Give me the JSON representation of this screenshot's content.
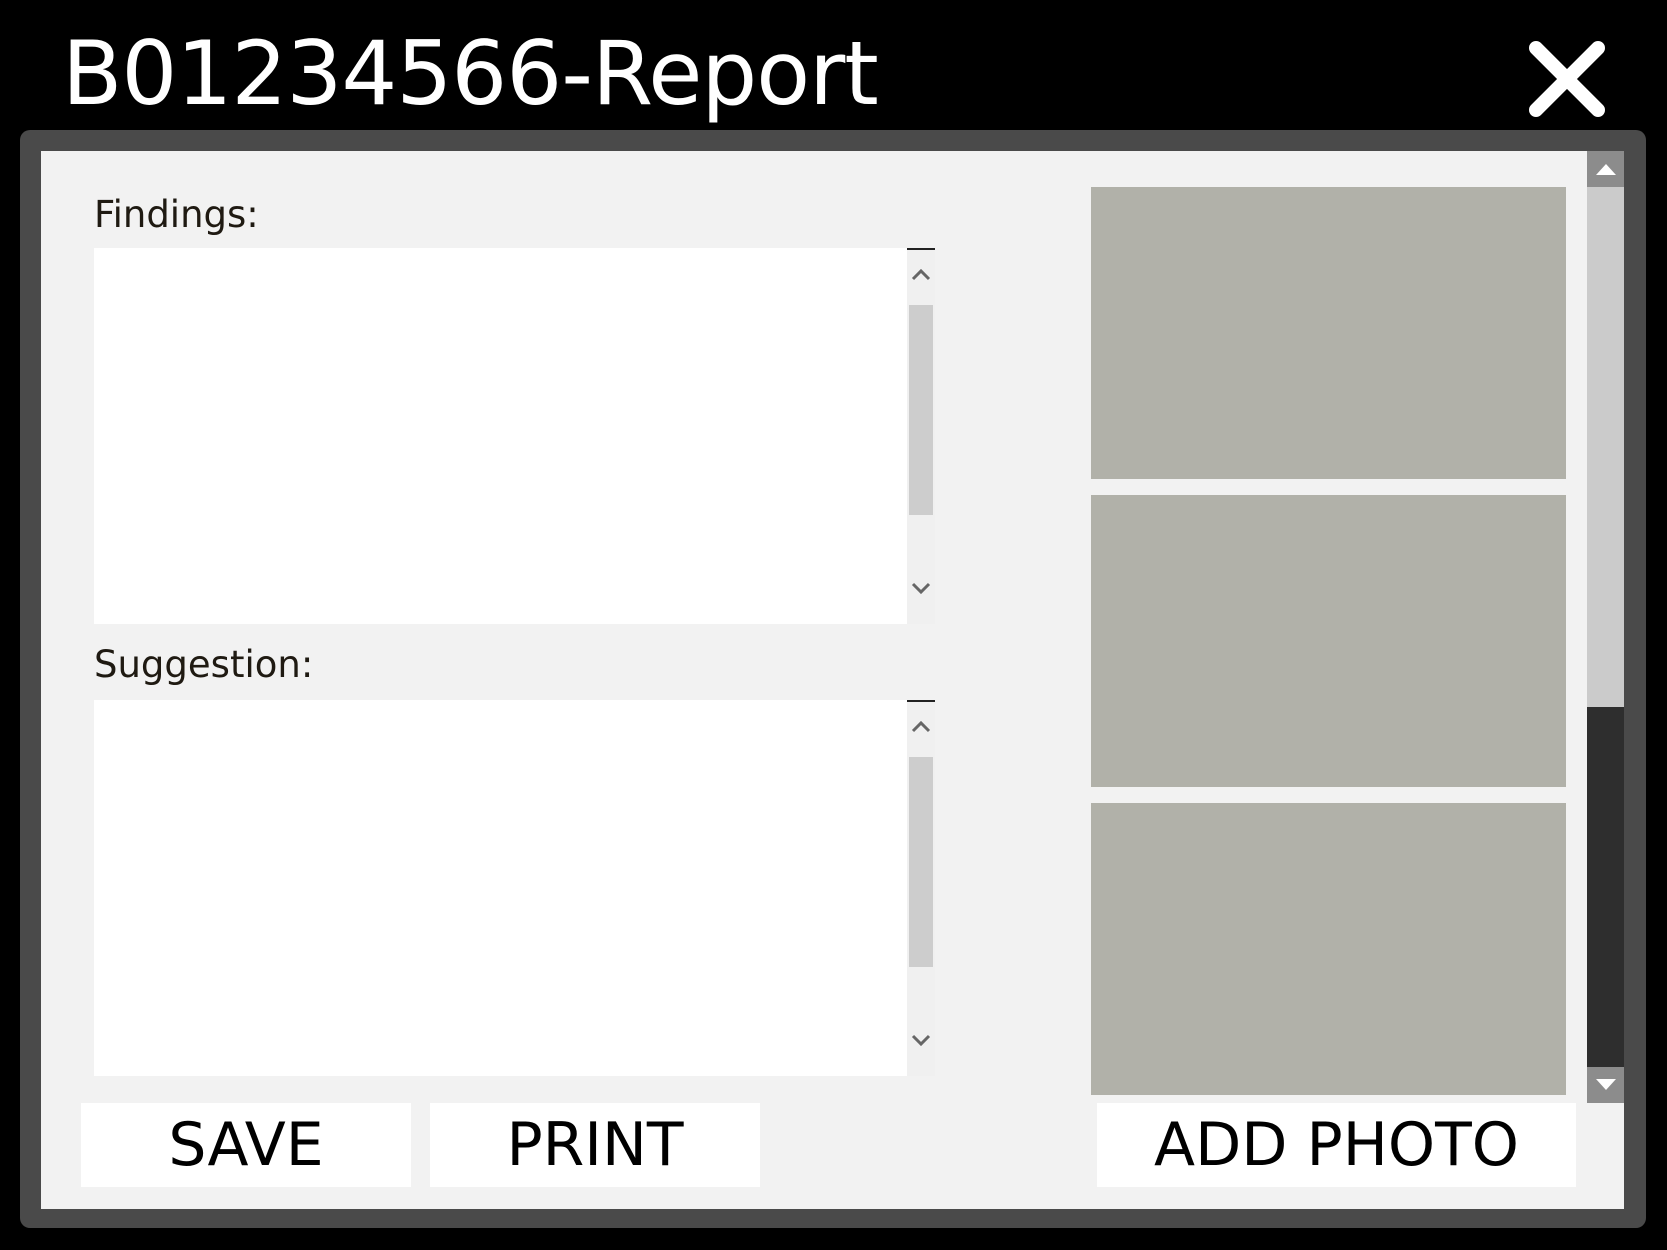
{
  "window": {
    "title": "B01234566-Report",
    "close_icon": "close-icon"
  },
  "findings": {
    "label": "Findings:",
    "value": ""
  },
  "suggestion": {
    "label": "Suggestion:",
    "value": ""
  },
  "photos": [
    {
      "name": "photo-placeholder-1"
    },
    {
      "name": "photo-placeholder-2"
    },
    {
      "name": "photo-placeholder-3"
    }
  ],
  "buttons": {
    "save": "SAVE",
    "print": "PRINT",
    "add_photo": "ADD PHOTO"
  },
  "colors": {
    "title_bar": "#000000",
    "frame": "#4a4a4a",
    "panel": "#f2f2f2",
    "photo_placeholder": "#b1b1a9",
    "scrollbar_track": "#2e2e2e",
    "scrollbar_thumb": "#cbcbcb"
  }
}
